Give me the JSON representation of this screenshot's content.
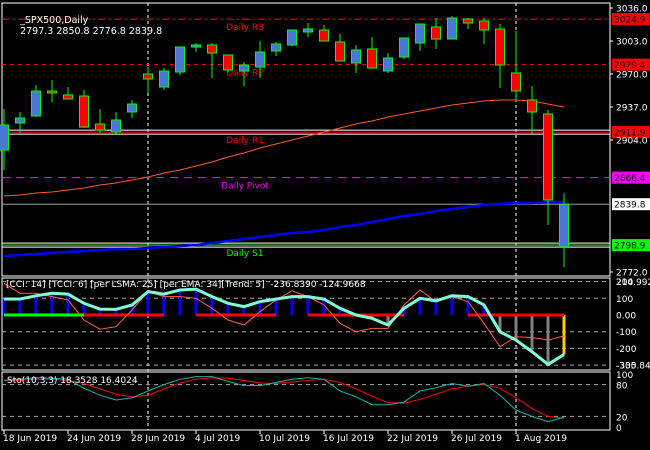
{
  "header": {
    "symbol": "_SPX500,Daily",
    "ohlc": "2797.3 2850.8 2776.8 2839.8"
  },
  "colors": {
    "bull_body": "#4a76d6",
    "bear_body": "#ff0000",
    "candle_outline": "#00ff00",
    "ema": "#ff5a1a",
    "ma": "#0000ff",
    "r_levels": "#ff0000",
    "pivot": "#ff00ff",
    "s1": "#00ff00",
    "cci_line": "#7fffd4",
    "tcci_line": "#ff6040",
    "hist_up": "#0000ff",
    "hist_down": "#808080",
    "hist_last": "#ffcc00",
    "sto_main": "#20b2aa",
    "sto_signal": "#ff0000"
  },
  "chart_data": [
    {
      "type": "candlestick",
      "title": "_SPX500,Daily",
      "ylim": [
        2772,
        3036
      ],
      "y_ticks": [
        "3036.0",
        "3003.0",
        "2970.0",
        "2937.0",
        "2904.0",
        "2772.0"
      ],
      "x_ticks": [
        {
          "index": 0,
          "label": "18 Jun 2019"
        },
        {
          "index": 4,
          "label": "24 Jun 2019"
        },
        {
          "index": 8,
          "label": "28 Jun 2019"
        },
        {
          "index": 12,
          "label": "4 Jul 2019"
        },
        {
          "index": 16,
          "label": "10 Jul 2019"
        },
        {
          "index": 20,
          "label": "16 Jul 2019"
        },
        {
          "index": 24,
          "label": "22 Jul 2019"
        },
        {
          "index": 28,
          "label": "26 Jul 2019"
        },
        {
          "index": 32,
          "label": "1 Aug 2019"
        }
      ],
      "period_separators": [
        9,
        32
      ],
      "ohlc": [
        [
          2894,
          2935,
          2874,
          2919
        ],
        [
          2921,
          2932,
          2911,
          2926
        ],
        [
          2928,
          2959,
          2927,
          2953
        ],
        [
          2953,
          2964,
          2942,
          2951
        ],
        [
          2949,
          2957,
          2945,
          2945
        ],
        [
          2948,
          2954,
          2916,
          2917
        ],
        [
          2920,
          2935,
          2911,
          2914
        ],
        [
          2912,
          2932,
          2910,
          2924
        ],
        [
          2932,
          2944,
          2926,
          2940
        ],
        [
          2970,
          2977,
          2951,
          2965
        ],
        [
          2957,
          2976,
          2954,
          2973
        ],
        [
          2972,
          2997,
          2969,
          2997
        ],
        [
          2997,
          3001,
          2992,
          2999
        ],
        [
          2999,
          3001,
          2966,
          2991
        ],
        [
          2989,
          2989,
          2972,
          2974
        ],
        [
          2973,
          2982,
          2958,
          2979
        ],
        [
          2977,
          3003,
          2966,
          2992
        ],
        [
          2993,
          3002,
          2988,
          3000
        ],
        [
          2999,
          3014,
          2998,
          3014
        ],
        [
          3012,
          3021,
          3007,
          3015
        ],
        [
          3014,
          3019,
          3003,
          3003
        ],
        [
          3002,
          3010,
          2983,
          2983
        ],
        [
          2981,
          2999,
          2971,
          2994
        ],
        [
          2995,
          3007,
          2976,
          2976
        ],
        [
          2973,
          2991,
          2971,
          2986
        ],
        [
          2987,
          3006,
          2985,
          3006
        ],
        [
          3001,
          3020,
          2993,
          3020
        ],
        [
          3017,
          3026,
          2995,
          3005
        ],
        [
          3005,
          3028,
          3005,
          3026
        ],
        [
          3025,
          3026,
          3015,
          3021
        ],
        [
          3023,
          3026,
          3000,
          3014
        ],
        [
          3015,
          3020,
          2956,
          2979
        ],
        [
          2971,
          3013,
          2943,
          2953
        ],
        [
          2944,
          2958,
          2910,
          2932
        ],
        [
          2930,
          2934,
          2819,
          2844
        ],
        [
          2797.3,
          2850.8,
          2776.8,
          2839.8
        ]
      ],
      "ema_line": [
        2848,
        2849,
        2851,
        2852,
        2854,
        2856,
        2859,
        2861,
        2864,
        2867,
        2871,
        2874,
        2878,
        2882,
        2887,
        2891,
        2896,
        2900,
        2904,
        2908,
        2912,
        2916,
        2920,
        2923,
        2927,
        2930,
        2933,
        2936,
        2939,
        2941,
        2943,
        2944,
        2944,
        2943,
        2940,
        2937
      ],
      "ma_line": [
        2788,
        2789,
        2790,
        2791,
        2792,
        2793,
        2794,
        2795,
        2795,
        2796,
        2797,
        2798,
        2799,
        2801,
        2803,
        2805,
        2807,
        2809,
        2811,
        2812,
        2814,
        2817,
        2819,
        2822,
        2825,
        2828,
        2830,
        2833,
        2835,
        2837,
        2839,
        2840,
        2841,
        2841,
        2842,
        2842
      ],
      "levels": [
        {
          "name": "Daily R3",
          "value": "3024.9",
          "style": "dashdot"
        },
        {
          "name": "Daily R2",
          "value": "2979.4",
          "style": "dash"
        },
        {
          "name": "Daily R1",
          "value": "2911.9",
          "style": "solid"
        },
        {
          "name": "Daily Pivot",
          "value": "2866.4",
          "style": "dash"
        },
        {
          "name": "Daily S1",
          "value": "2798.9",
          "style": "solid"
        }
      ],
      "current_price": "2839.8"
    },
    {
      "type": "line",
      "title": "[CCI: 14] [TCCI: 6] [per LSMA: 25] [per EMA: 34][Trend: 5]  -236.8390 -124.9668",
      "ylim": [
        -300,
        200
      ],
      "y_ticks": [
        "200",
        "214.9929",
        "100",
        "0.00",
        "-100",
        "-200",
        "-300",
        "-335.849"
      ],
      "series": [
        {
          "name": "CCI",
          "values": [
            96,
            96,
            115,
            130,
            125,
            70,
            35,
            34,
            60,
            140,
            125,
            150,
            155,
            110,
            70,
            50,
            80,
            95,
            110,
            110,
            95,
            40,
            0,
            -20,
            -60,
            40,
            100,
            85,
            115,
            110,
            60,
            -100,
            -150,
            -220,
            -296,
            -236.839
          ]
        },
        {
          "name": "TCCI",
          "values": [
            190,
            130,
            130,
            110,
            90,
            -30,
            -85,
            -70,
            30,
            140,
            110,
            110,
            100,
            40,
            -30,
            -60,
            20,
            90,
            145,
            110,
            60,
            -50,
            -100,
            -80,
            -80,
            60,
            150,
            80,
            110,
            80,
            -50,
            -190,
            -130,
            -135,
            -150,
            -124.9668
          ]
        }
      ],
      "trend": [
        "up",
        "up",
        "up",
        "up",
        "up",
        "down",
        "down",
        "down",
        "down",
        "down",
        "down",
        null,
        "down",
        "down",
        "down",
        "down",
        "down",
        "down",
        null,
        "down",
        "down",
        "down",
        "down",
        "down",
        "down",
        "down",
        null,
        null,
        null,
        "down",
        "down",
        "down",
        "down",
        "down",
        "down",
        "down"
      ]
    },
    {
      "type": "line",
      "title": "Sto(10,3,3) 18.3528 16.4024",
      "ylim": [
        0,
        100
      ],
      "y_ticks": [
        "100",
        "80",
        "20",
        "0"
      ],
      "series": [
        {
          "name": "Main",
          "values": [
            88,
            90,
            93,
            92,
            90,
            73,
            60,
            51,
            55,
            68,
            80,
            90,
            95,
            95,
            86,
            78,
            78,
            84,
            90,
            93,
            90,
            68,
            57,
            42,
            42,
            47,
            68,
            74,
            82,
            77,
            82,
            60,
            32,
            20,
            10,
            18.3528
          ]
        },
        {
          "name": "Signal",
          "values": [
            88,
            88,
            90,
            90,
            88,
            82,
            72,
            62,
            57,
            60,
            72,
            83,
            90,
            93,
            92,
            88,
            83,
            82,
            85,
            88,
            90,
            84,
            72,
            58,
            46,
            45,
            52,
            62,
            72,
            77,
            80,
            73,
            55,
            35,
            20,
            16.4024
          ]
        }
      ]
    }
  ]
}
